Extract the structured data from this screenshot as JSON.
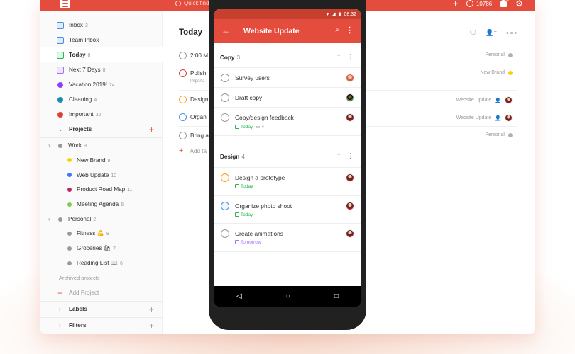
{
  "topbar": {
    "quick_find": "Quick find",
    "karma": "10786"
  },
  "sidebar": {
    "items": [
      {
        "label": "Inbox",
        "count": "2",
        "color": "#4a90e2"
      },
      {
        "label": "Team Inbox",
        "count": "",
        "color": "#4a90e2"
      },
      {
        "label": "Today",
        "count": "8",
        "color": "#25b84c"
      },
      {
        "label": "Next 7 Days",
        "count": "8",
        "color": "#a970ff"
      },
      {
        "label": "Vacation 2019!",
        "count": "24",
        "color": "#8b40ff"
      },
      {
        "label": "Cleaning",
        "count": "4",
        "color": "#158fad"
      },
      {
        "label": "Important",
        "count": "32",
        "color": "#db4035"
      }
    ],
    "projects_header": "Projects",
    "projects": [
      {
        "label": "Work",
        "count": "9",
        "color": "#999999",
        "level": 0
      },
      {
        "label": "New Brand",
        "count": "9",
        "color": "#fad000",
        "level": 1
      },
      {
        "label": "Web Update",
        "count": "10",
        "color": "#4073ff",
        "level": 1
      },
      {
        "label": "Product Road Map",
        "count": "11",
        "color": "#b8255f",
        "level": 1
      },
      {
        "label": "Meeting Agenda",
        "count": "6",
        "color": "#7ecc49",
        "level": 1
      },
      {
        "label": "Personal",
        "count": "2",
        "color": "#999999",
        "level": 0
      },
      {
        "label": "Fitness 💪",
        "count": "9",
        "color": "#999999",
        "level": 1
      },
      {
        "label": "Groceries 🛍",
        "count": "7",
        "color": "#999999",
        "level": 1
      },
      {
        "label": "Reading List 📖",
        "count": "6",
        "color": "#999999",
        "level": 1
      }
    ],
    "archived": "Archived projects",
    "add_project": "Add Project",
    "labels": "Labels",
    "filters": "Filters"
  },
  "main": {
    "title": "Today",
    "tasks": [
      {
        "title": "2:00 M",
        "sub": "",
        "project": "Personal",
        "color": "#b0b0b0",
        "circle": "#999999"
      },
      {
        "title": "Polish",
        "sub": "Importa",
        "project": "New Brand",
        "color": "#fad000",
        "circle": "#db4035"
      },
      {
        "title": "Design",
        "sub": "",
        "project": "Website Update",
        "color": "#4073ff",
        "circle": "#f5a623"
      },
      {
        "title": "Organi",
        "sub": "",
        "project": "Website Update",
        "color": "#4073ff",
        "circle": "#4a90e2"
      },
      {
        "title": "Bring a",
        "sub": "",
        "project": "Personal",
        "color": "#b0b0b0",
        "circle": "#999999"
      }
    ],
    "add_task": "Add ta"
  },
  "phone": {
    "time": "08:32",
    "title": "Website Update",
    "sections": [
      {
        "name": "Copy",
        "count": "3"
      },
      {
        "name": "Design",
        "count": "4"
      }
    ],
    "tasks": [
      {
        "title": "Survey users",
        "date": "",
        "comments": "",
        "circle": "#999999"
      },
      {
        "title": "Draft copy",
        "date": "",
        "comments": "",
        "circle": "#999999"
      },
      {
        "title": "Copy/design feedback",
        "date": "Today",
        "comments": "4",
        "circle": "#999999",
        "date_color": "#25b84c"
      },
      {
        "title": "Design a prototype",
        "date": "Today",
        "comments": "",
        "circle": "#f5a623",
        "date_color": "#25b84c"
      },
      {
        "title": "Organize photo shoot",
        "date": "Today",
        "comments": "",
        "circle": "#4a90e2",
        "date_color": "#25b84c"
      },
      {
        "title": "Create animations",
        "date": "Tomorrow",
        "comments": "",
        "circle": "#999999",
        "date_color": "#a970ff"
      }
    ]
  }
}
